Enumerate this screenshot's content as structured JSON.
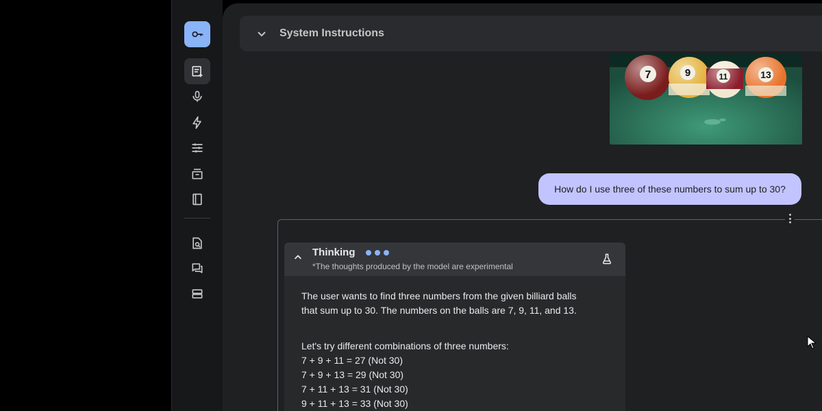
{
  "header": {
    "system_instructions_label": "System Instructions"
  },
  "rail": {
    "icons": [
      "key-icon",
      "new-prompt-icon",
      "mic-icon",
      "lightning-icon",
      "tune-icon",
      "archive-icon",
      "library-icon",
      "search-doc-icon",
      "chat-icon",
      "storage-icon"
    ]
  },
  "image": {
    "ball_numbers": [
      "7",
      "9",
      "11",
      "13"
    ]
  },
  "chat": {
    "user_message": "How do I use three of these numbers to sum up to 30?",
    "thinking": {
      "title": "Thinking",
      "subtitle": "*The thoughts produced by the model are experimental",
      "paragraph1_line1": "The user wants to find three numbers from the given billiard balls",
      "paragraph1_line2": "that sum up to 30. The numbers on the balls are 7, 9, 11, and 13.",
      "intro": "Let's try different combinations of three numbers:",
      "lines": [
        "7 + 9 + 11 = 27 (Not 30)",
        "7 + 9 + 13 = 29 (Not 30)",
        "7 + 11 + 13 = 31 (Not 30)",
        "9 + 11 + 13 = 33 (Not 30)"
      ]
    }
  },
  "colors": {
    "accent": "#8ab4f8",
    "user_bubble": "#c2c4ff",
    "panel": "#1f2022"
  }
}
